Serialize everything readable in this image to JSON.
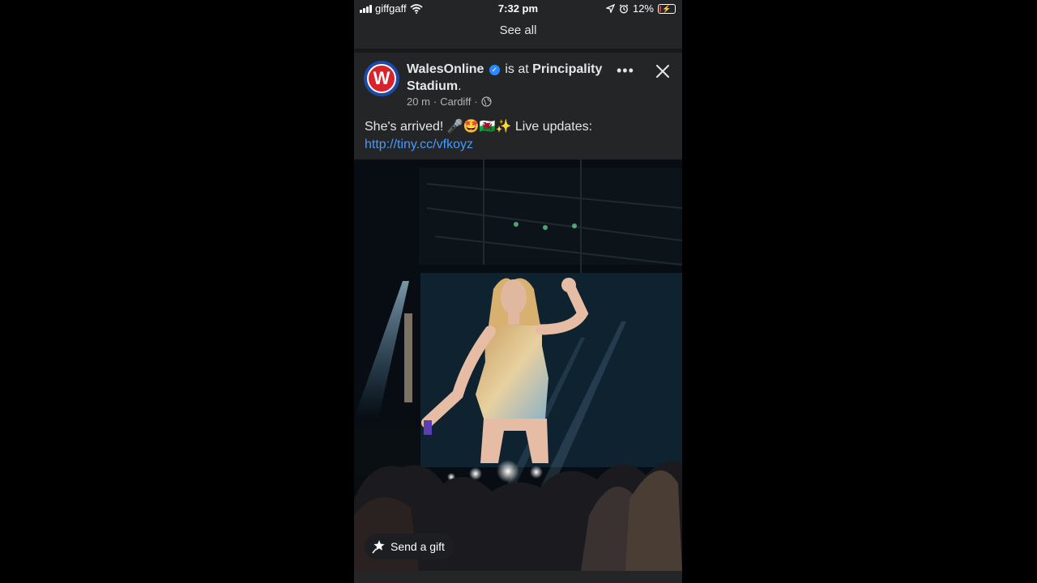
{
  "status_bar": {
    "carrier": "giffgaff",
    "time": "7:32 pm",
    "battery": "12%",
    "battery_level": 0.12
  },
  "stories": {
    "see_all": "See all"
  },
  "post": {
    "page_name": "WalesOnline",
    "avatar_letter": "W",
    "checkin_prefix": "is at",
    "location": "Principality Stadium",
    "period": ".",
    "time_ago": "20 m",
    "separator": "·",
    "place": "Cardiff",
    "text": "She's arrived! 🎤🤩🏴󠁧󠁢󠁷󠁬󠁳󠁿✨ Live updates: ",
    "link_text": "http://tiny.cc/vfkoyz",
    "send_gift": "Send a gift"
  },
  "icons": [
    "signal-icon",
    "wifi-icon",
    "location-arrow-icon",
    "alarm-icon",
    "battery-icon",
    "verified-icon",
    "globe-icon",
    "more-icon",
    "close-icon",
    "gift-icon"
  ],
  "colors": {
    "background": "#242526",
    "link": "#4599ff",
    "verified": "#2d88ff",
    "brand_red": "#d8232a",
    "brand_blue": "#1d4aa8"
  }
}
